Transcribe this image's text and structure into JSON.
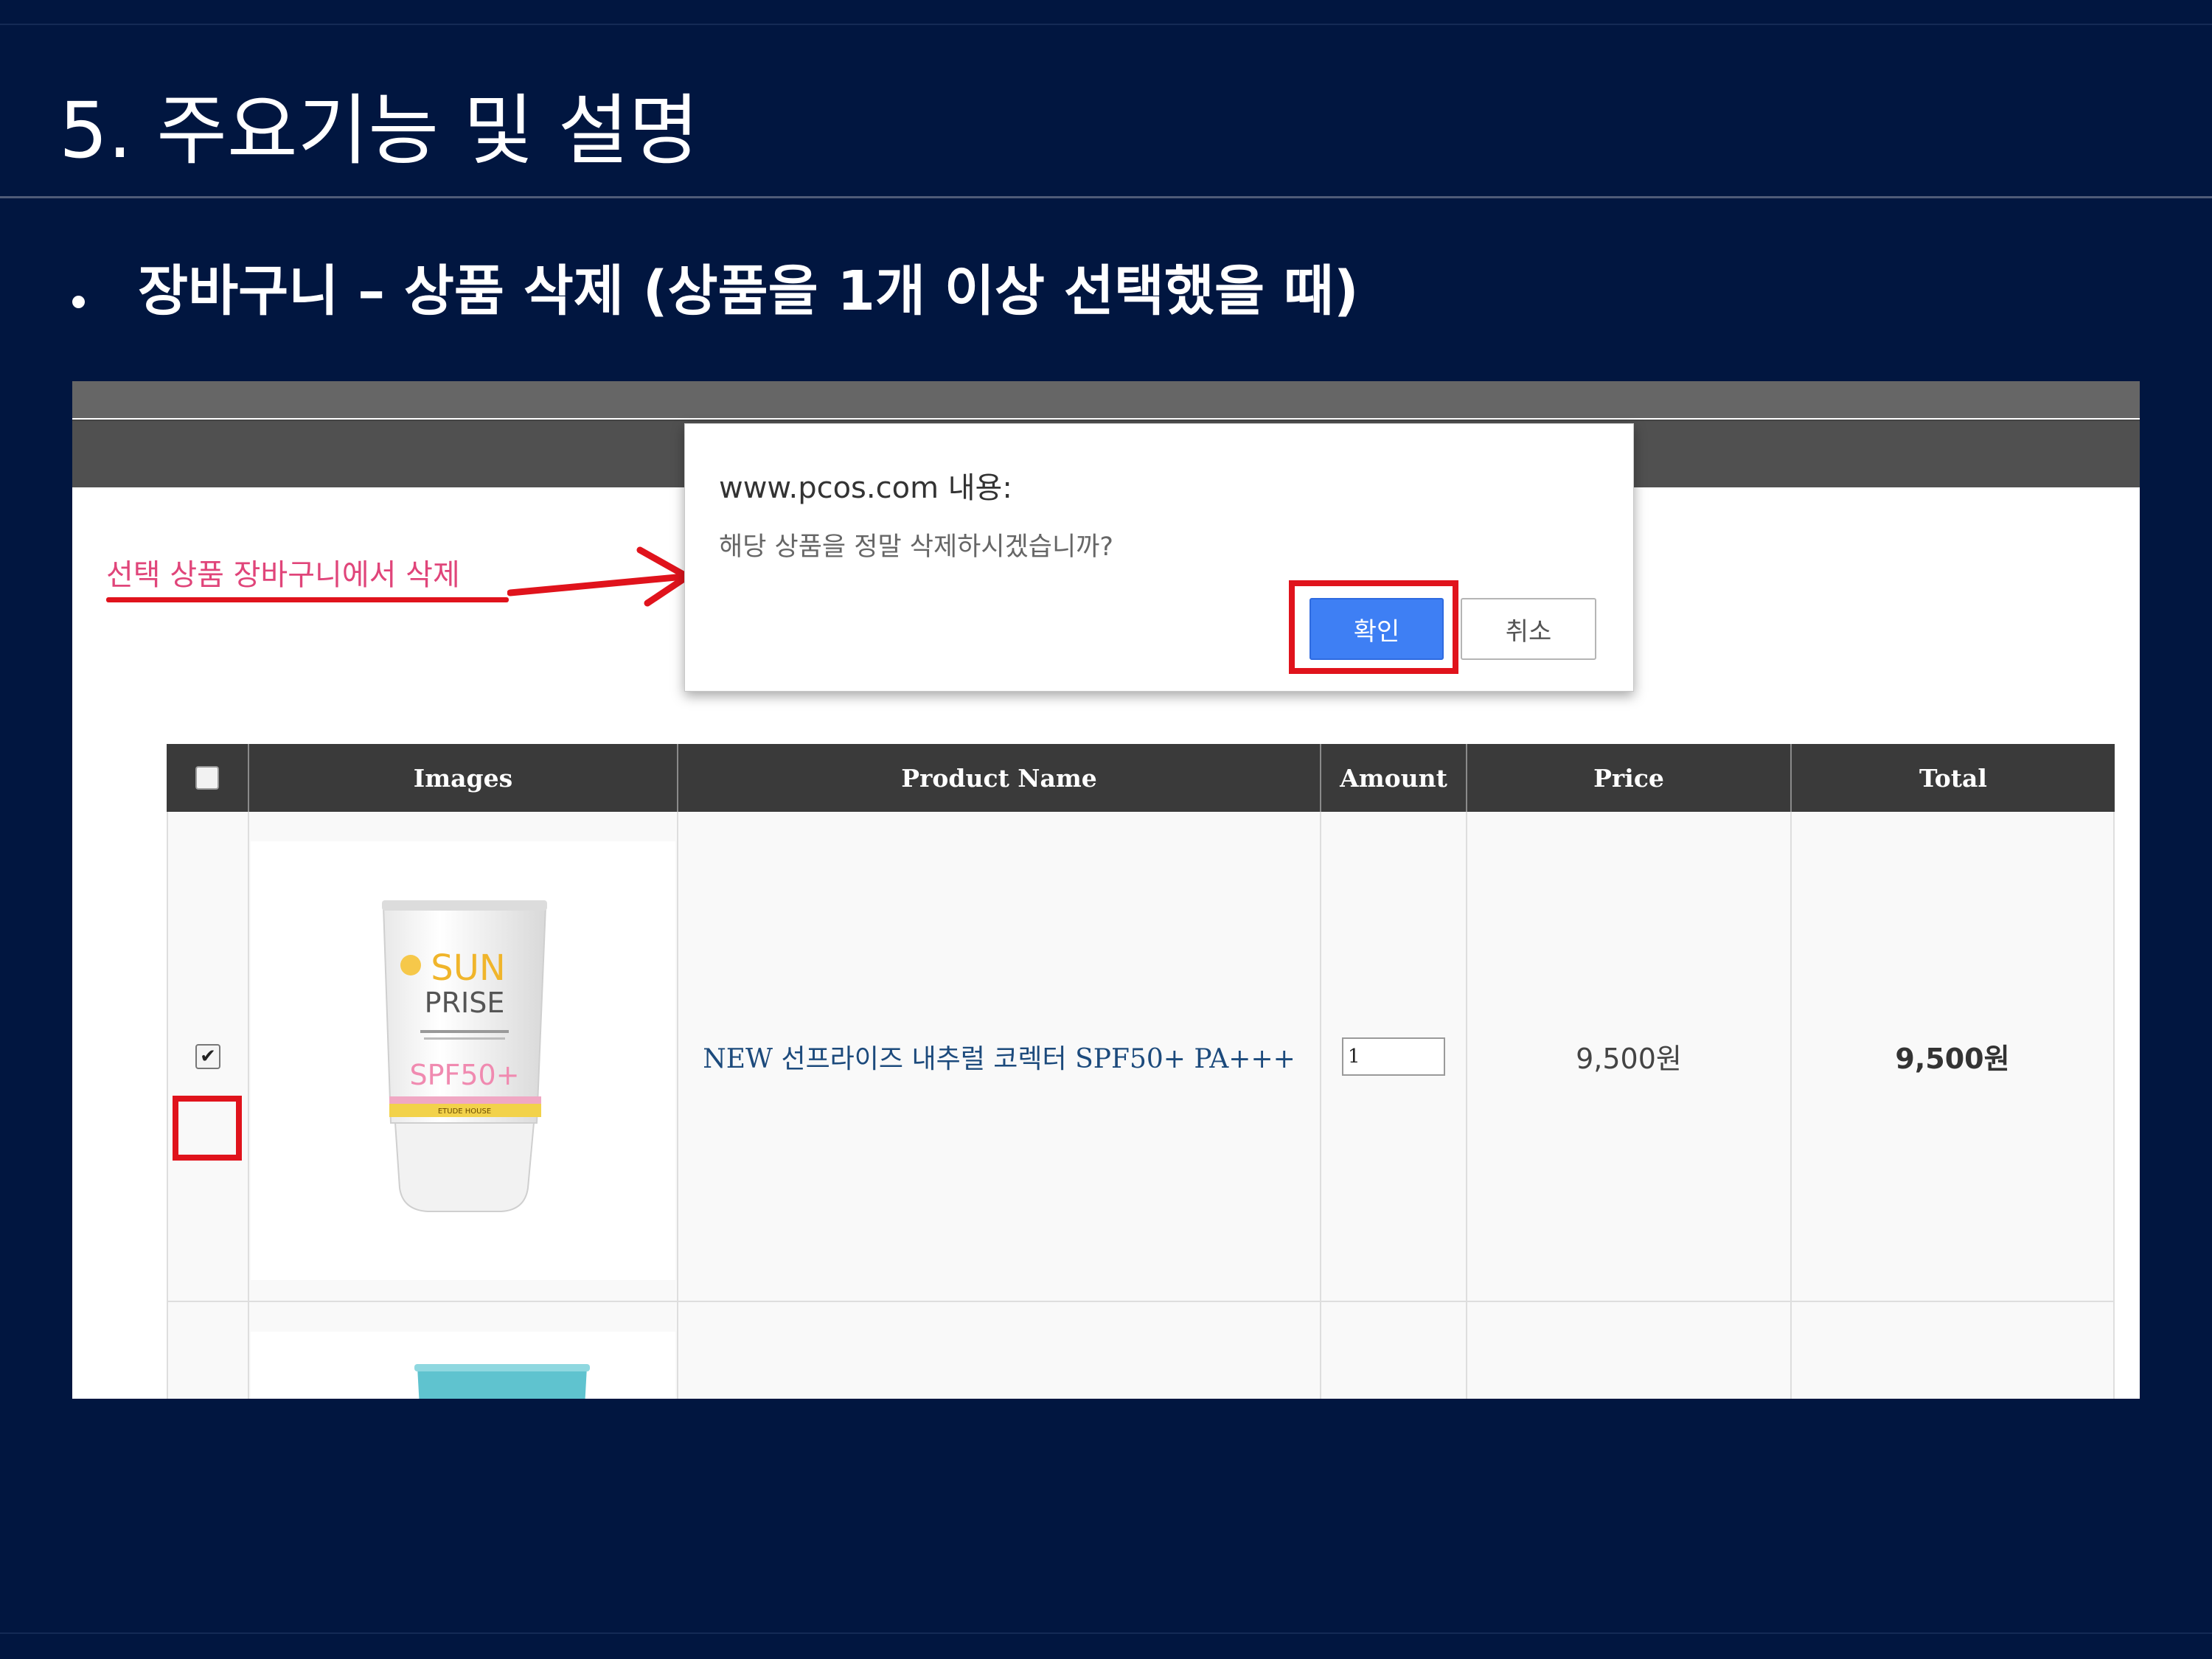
{
  "slide": {
    "title": "5. 주요기능 및 설명",
    "bullet": "장바구니 – 상품 삭제 (상품을 1개 이상 선택했을 때)"
  },
  "annotation": {
    "label": "선택 상품 장바구니에서 삭제",
    "color": "#e0457a",
    "highlight_color": "#e0131c"
  },
  "dialog": {
    "title": "www.pcos.com 내용:",
    "message": "해당 상품을 정말 삭제하시겠습니까?",
    "ok_label": "확인",
    "cancel_label": "취소",
    "ok_color": "#3e7ff4"
  },
  "cart": {
    "headers": [
      "Images",
      "Product Name",
      "Amount",
      "Price",
      "Total"
    ],
    "rows": [
      {
        "checked": true,
        "image_icon": "sunscreen-tube-icon",
        "product_name": "NEW 선프라이즈 내추럴 코렉터 SPF50+ PA+++",
        "amount": "1",
        "price": "9,500원",
        "total": "9,500원"
      }
    ],
    "product_image_text": {
      "brand_line1": "SUN",
      "brand_line2": "PRISE",
      "spf": "SPF50+",
      "maker": "ETUDE HOUSE"
    }
  },
  "colors": {
    "background": "#011640",
    "table_header": "#3a3a3a"
  }
}
